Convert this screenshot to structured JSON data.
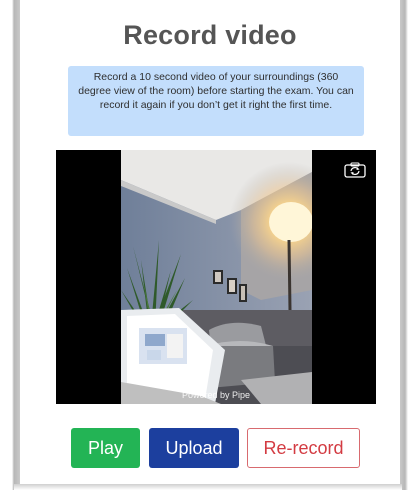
{
  "page": {
    "title": "Record video",
    "instructions": "Record a 10 second video of your surroundings (360 degree view of the room) before starting the exam. You can record it again if you don’t get it right the first time."
  },
  "video": {
    "powered_by": "Powered by Pipe",
    "camera_switch_icon": "camera-switch-icon"
  },
  "buttons": {
    "play": "Play",
    "upload": "Upload",
    "rerecord": "Re-record"
  },
  "colors": {
    "play": "#23b455",
    "upload": "#1c3f9e",
    "rerecord": "#d33b42",
    "info_box": "#c3defc"
  }
}
